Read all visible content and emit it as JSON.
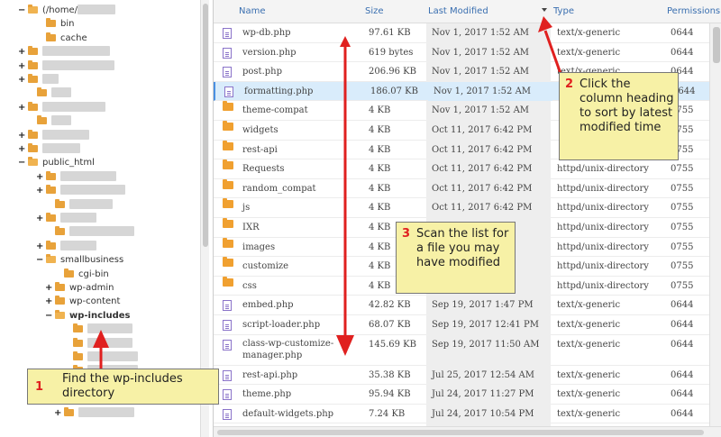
{
  "tree": {
    "nodes": [
      {
        "toggle": "−",
        "label": "(/home/",
        "blurred_suffix": true,
        "open": true,
        "bold": false
      },
      {
        "toggle": "",
        "label": "bin",
        "open": false,
        "bold": false
      },
      {
        "toggle": "",
        "label": "cache",
        "open": false,
        "bold": false
      },
      {
        "toggle": "+",
        "label": "",
        "open": false,
        "bold": false
      },
      {
        "toggle": "+",
        "label": "",
        "open": false,
        "bold": false
      },
      {
        "toggle": "+",
        "label": "",
        "open": false,
        "bold": false
      },
      {
        "toggle": "",
        "label": "",
        "open": false,
        "bold": false
      },
      {
        "toggle": "+",
        "label": "",
        "open": false,
        "bold": false
      },
      {
        "toggle": "",
        "label": "",
        "open": false,
        "bold": false
      },
      {
        "toggle": "+",
        "label": "",
        "open": false,
        "bold": false
      },
      {
        "toggle": "+",
        "label": "",
        "open": false,
        "bold": false
      },
      {
        "toggle": "−",
        "label": "public_html",
        "open": true,
        "bold": false
      },
      {
        "toggle": "+",
        "label": "",
        "open": false,
        "bold": false
      },
      {
        "toggle": "+",
        "label": "",
        "open": false,
        "bold": false
      },
      {
        "toggle": "",
        "label": "",
        "open": false,
        "bold": false
      },
      {
        "toggle": "+",
        "label": "",
        "open": false,
        "bold": false
      },
      {
        "toggle": "",
        "label": "",
        "open": false,
        "bold": false
      },
      {
        "toggle": "+",
        "label": "",
        "open": false,
        "bold": false
      },
      {
        "toggle": "−",
        "label": "smallbusiness",
        "open": true,
        "bold": false
      },
      {
        "toggle": "",
        "label": "cgi-bin",
        "open": false,
        "bold": false
      },
      {
        "toggle": "+",
        "label": "wp-admin",
        "open": false,
        "bold": false
      },
      {
        "toggle": "+",
        "label": "wp-content",
        "open": false,
        "bold": false
      },
      {
        "toggle": "−",
        "label": "wp-includes",
        "open": true,
        "bold": true
      },
      {
        "toggle": "",
        "label": "",
        "open": false,
        "bold": false
      },
      {
        "toggle": "",
        "label": "",
        "open": false,
        "bold": false
      },
      {
        "toggle": "",
        "label": "",
        "open": false,
        "bold": false
      },
      {
        "toggle": "",
        "label": "",
        "open": false,
        "bold": false
      },
      {
        "toggle": "",
        "label": "",
        "open": false,
        "bold": false
      },
      {
        "toggle": "",
        "label": "",
        "open": false,
        "bold": false
      },
      {
        "toggle": "+",
        "label": "",
        "open": false,
        "bold": false
      }
    ]
  },
  "filelist": {
    "columns": {
      "name": "Name",
      "size": "Size",
      "last_modified": "Last Modified",
      "type": "Type",
      "permissions": "Permissions"
    },
    "sort_indicator": "sort-desc-arrow",
    "rows": [
      {
        "icon": "file",
        "name": "wp-db.php",
        "size": "97.61 KB",
        "modified": "Nov 1, 2017 1:52 AM",
        "type": "text/x-generic",
        "perms": "0644"
      },
      {
        "icon": "file",
        "name": "version.php",
        "size": "619 bytes",
        "modified": "Nov 1, 2017 1:52 AM",
        "type": "text/x-generic",
        "perms": "0644"
      },
      {
        "icon": "file",
        "name": "post.php",
        "size": "206.96 KB",
        "modified": "Nov 1, 2017 1:52 AM",
        "type": "text/x-generic",
        "perms": "0644"
      },
      {
        "icon": "file",
        "name": "formatting.php",
        "size": "186.07 KB",
        "modified": "Nov 1, 2017 1:52 AM",
        "type": "",
        "perms": "0644",
        "selected": true
      },
      {
        "icon": "dir",
        "name": "theme-compat",
        "size": "4 KB",
        "modified": "Nov 1, 2017 1:52 AM",
        "type": "",
        "perms": "0755"
      },
      {
        "icon": "dir",
        "name": "widgets",
        "size": "4 KB",
        "modified": "Oct 11, 2017 6:42 PM",
        "type": "",
        "perms": "0755"
      },
      {
        "icon": "dir",
        "name": "rest-api",
        "size": "4 KB",
        "modified": "Oct 11, 2017 6:42 PM",
        "type": "",
        "perms": "0755"
      },
      {
        "icon": "dir",
        "name": "Requests",
        "size": "4 KB",
        "modified": "Oct 11, 2017 6:42 PM",
        "type": "httpd/unix-directory",
        "perms": "0755"
      },
      {
        "icon": "dir",
        "name": "random_compat",
        "size": "4 KB",
        "modified": "Oct 11, 2017 6:42 PM",
        "type": "httpd/unix-directory",
        "perms": "0755"
      },
      {
        "icon": "dir",
        "name": "js",
        "size": "4 KB",
        "modified": "Oct 11, 2017 6:42 PM",
        "type": "httpd/unix-directory",
        "perms": "0755"
      },
      {
        "icon": "dir",
        "name": "IXR",
        "size": "4 KB",
        "modified": "",
        "type": "httpd/unix-directory",
        "perms": "0755"
      },
      {
        "icon": "dir",
        "name": "images",
        "size": "4 KB",
        "modified": "",
        "type": "httpd/unix-directory",
        "perms": "0755"
      },
      {
        "icon": "dir",
        "name": "customize",
        "size": "4 KB",
        "modified": "",
        "type": "httpd/unix-directory",
        "perms": "0755"
      },
      {
        "icon": "dir",
        "name": "css",
        "size": "4 KB",
        "modified": "",
        "type": "httpd/unix-directory",
        "perms": "0755"
      },
      {
        "icon": "file",
        "name": "embed.php",
        "size": "42.82 KB",
        "modified": "Sep 19, 2017 1:47 PM",
        "type": "text/x-generic",
        "perms": "0644"
      },
      {
        "icon": "file",
        "name": "script-loader.php",
        "size": "68.07 KB",
        "modified": "Sep 19, 2017 12:41 PM",
        "type": "text/x-generic",
        "perms": "0644"
      },
      {
        "icon": "file",
        "name": "class-wp-customize-manager.php",
        "name_line1": "class-wp-customize-",
        "name_line2": "manager.php",
        "size": "145.69 KB",
        "modified": "Sep 19, 2017 11:50 AM",
        "type": "text/x-generic",
        "perms": "0644"
      },
      {
        "icon": "file",
        "name": "rest-api.php",
        "size": "35.38 KB",
        "modified": "Jul 25, 2017 12:54 AM",
        "type": "text/x-generic",
        "perms": "0644"
      },
      {
        "icon": "file",
        "name": "theme.php",
        "size": "95.94 KB",
        "modified": "Jul 24, 2017 11:27 PM",
        "type": "text/x-generic",
        "perms": "0644"
      },
      {
        "icon": "file",
        "name": "default-widgets.php",
        "size": "7.24 KB",
        "modified": "Jul 24, 2017 10:54 PM",
        "type": "text/x-generic",
        "perms": "0644"
      },
      {
        "icon": "file",
        "name": "",
        "size": "",
        "modified": "",
        "type": "",
        "perms": ""
      }
    ]
  },
  "callouts": {
    "step1": {
      "num": "1",
      "text": "Find the wp-includes directory"
    },
    "step2": {
      "num": "2",
      "text": "Click the column heading to sort by latest modified time"
    },
    "step3": {
      "num": "3",
      "text": "Scan the list for a file you may have modified"
    }
  },
  "colors": {
    "accent_link": "#3a6fb0",
    "arrow_red": "#e0201f",
    "callout_bg": "#f7f1a6",
    "selected_row": "#d9ecfb"
  }
}
